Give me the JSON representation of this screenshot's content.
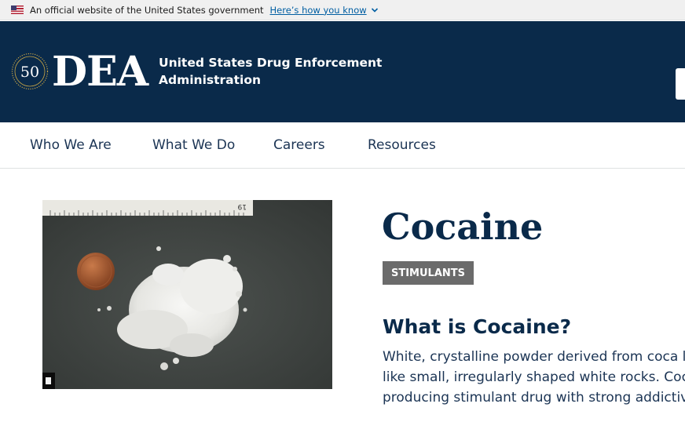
{
  "gov_banner": {
    "text": "An official website of the United States government",
    "link_label": "Here’s how you know"
  },
  "header": {
    "seal_number": "50",
    "logo_text": "DEA",
    "agency_line1": "United States Drug Enforcement",
    "agency_line2": "Administration"
  },
  "nav": {
    "items": [
      {
        "label": "Who We Are"
      },
      {
        "label": "What We Do"
      },
      {
        "label": "Careers"
      },
      {
        "label": "Resources"
      }
    ]
  },
  "content": {
    "title": "Cocaine",
    "category": "STIMULANTS",
    "section_heading": "What is Cocaine?",
    "section_lines": [
      "White, crystalline powder derived from coca le",
      "like small, irregularly shaped white rocks. Coca",
      "producing stimulant drug with strong addictive"
    ],
    "photo_ruler_label": "19"
  },
  "colors": {
    "header_bg": "#0a2a4a",
    "link": "#005ea2",
    "tag_bg": "#6b6b6b",
    "title": "#0a2a4a"
  }
}
